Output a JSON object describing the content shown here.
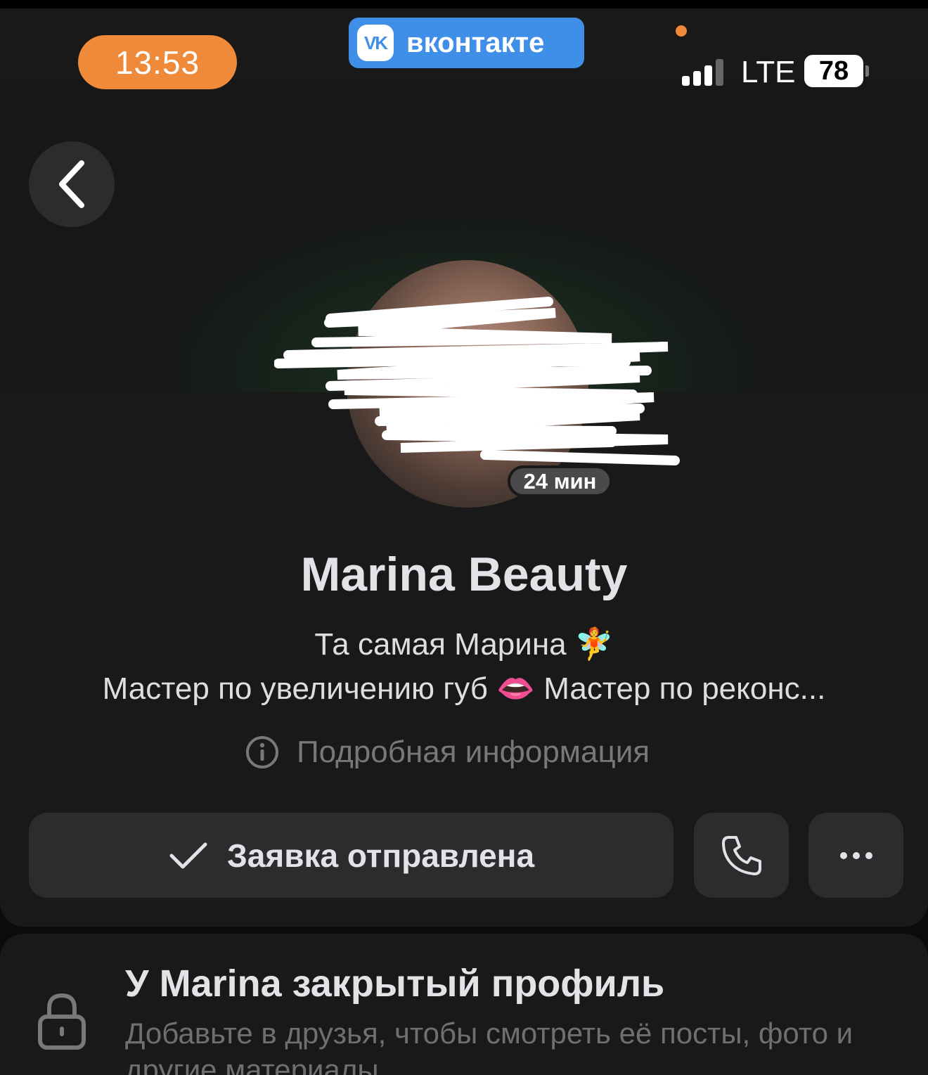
{
  "status_bar": {
    "time": "13:53",
    "app_badge": "вконтакте",
    "app_logo": "VK",
    "network": "LTE",
    "battery": "78",
    "signal_icon": "signal-bars-icon"
  },
  "profile": {
    "name": "Marina Beauty",
    "last_seen": "24 мин",
    "status_line1": "Та самая Марина 🧚",
    "status_line2": "Мастер по увеличению губ 👄 Мастер по реконс...",
    "more_info": "Подробная информация"
  },
  "actions": {
    "request_label": "Заявка отправлена",
    "call_icon": "phone-icon",
    "more_icon": "more-dots-icon"
  },
  "private_notice": {
    "title": "У Marina закрытый профиль",
    "text": "Добавьте в друзья, чтобы смотреть её посты, фото и другие материалы"
  },
  "colors": {
    "time_pill": "#ee8a3a",
    "vk_badge": "#3f8ee8",
    "card_bg": "#19191a",
    "button_bg": "#2c2c2e"
  }
}
